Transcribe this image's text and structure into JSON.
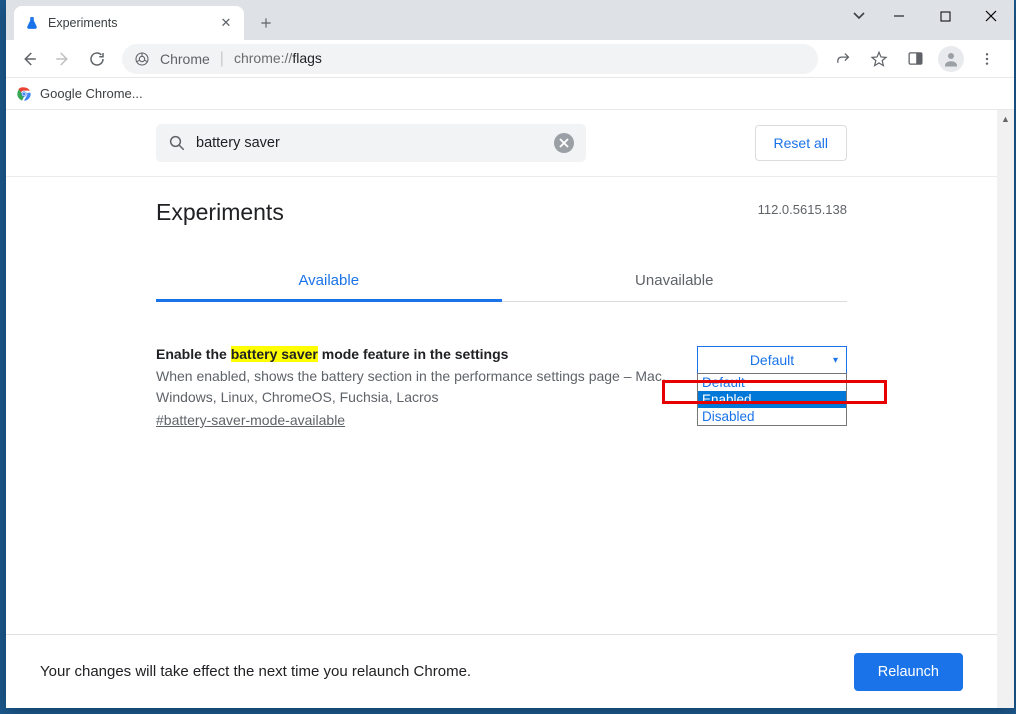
{
  "tab": {
    "title": "Experiments"
  },
  "omnibox": {
    "chrome_label": "Chrome",
    "url_prefix": "chrome://",
    "url_path": "flags"
  },
  "bookmark": {
    "label": "Google Chrome..."
  },
  "search": {
    "value": "battery saver"
  },
  "reset_label": "Reset all",
  "page_title": "Experiments",
  "version": "112.0.5615.138",
  "tabs": {
    "available": "Available",
    "unavailable": "Unavailable"
  },
  "flag": {
    "title_prefix": "Enable the ",
    "title_highlight": "battery saver",
    "title_suffix": " mode feature in the settings",
    "description": "When enabled, shows the battery section in the performance settings page – Mac, Windows, Linux, ChromeOS, Fuchsia, Lacros",
    "link": "#battery-saver-mode-available",
    "selected": "Default",
    "options": {
      "opt0": "Default",
      "opt1": "Enabled",
      "opt2": "Disabled"
    }
  },
  "relaunch": {
    "message": "Your changes will take effect the next time you relaunch Chrome.",
    "button": "Relaunch"
  }
}
